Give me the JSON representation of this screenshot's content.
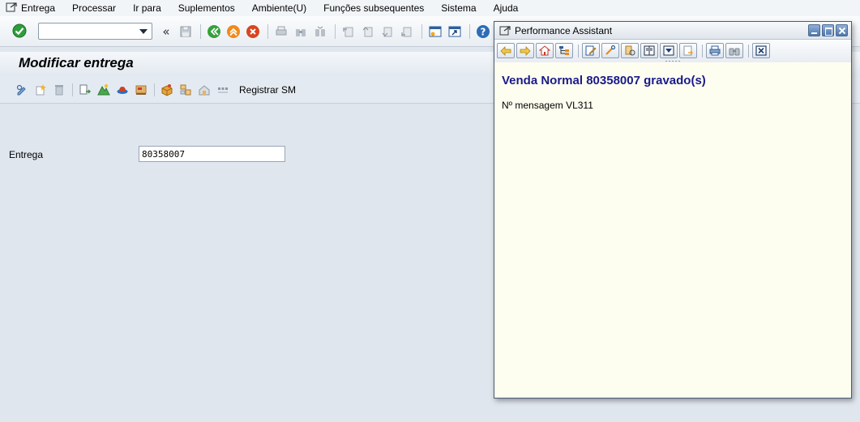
{
  "menubar": {
    "items": [
      "Entrega",
      "Processar",
      "Ir para",
      "Suplementos",
      "Ambiente(U)",
      "Funções subsequentes",
      "Sistema",
      "Ajuda"
    ]
  },
  "title": "Modificar entrega",
  "app_toolbar": {
    "register_label": "Registrar SM"
  },
  "form": {
    "entrega_label": "Entrega",
    "entrega_value": "80358007"
  },
  "performance_assistant": {
    "window_title": "Performance Assistant",
    "heading": "Venda Normal 80358007 gravado(s)",
    "message": "Nº mensagem VL311"
  },
  "colors": {
    "accent_green": "#2e9e3a",
    "heading_blue": "#1a1a8a",
    "pa_background": "#fefef0"
  }
}
